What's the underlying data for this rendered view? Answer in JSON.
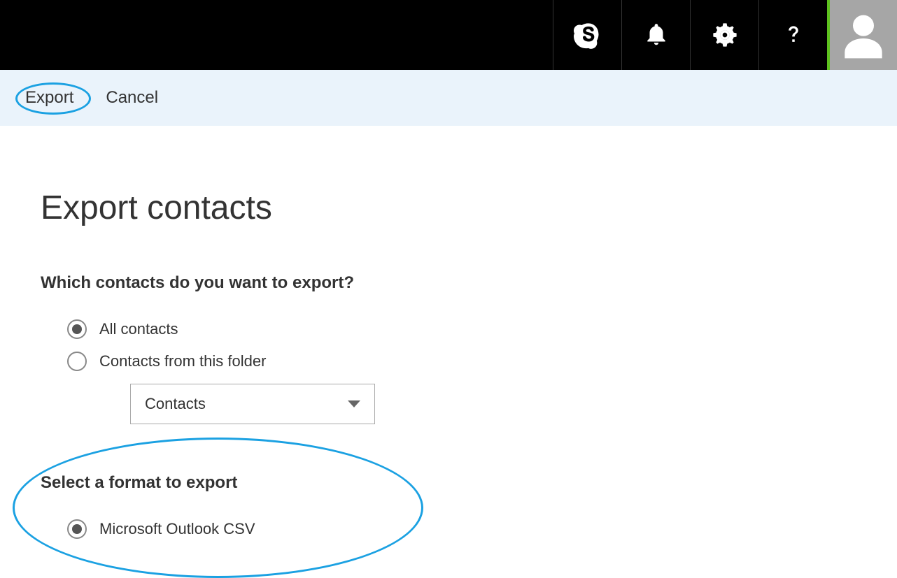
{
  "commandBar": {
    "export_label": "Export",
    "cancel_label": "Cancel"
  },
  "page": {
    "title": "Export contacts",
    "question1": "Which contacts do you want to export?",
    "question2": "Select a format to export"
  },
  "radios_contacts": {
    "all_label": "All contacts",
    "folder_label": "Contacts from this folder",
    "dropdown_selected": "Contacts",
    "all_selected": true,
    "folder_selected": false
  },
  "radios_format": {
    "outlook_label": "Microsoft Outlook CSV",
    "outlook_selected": true
  },
  "icons": {
    "skype": "skype-icon",
    "notifications": "bell-icon",
    "settings": "gear-icon",
    "help": "help-icon",
    "profile": "profile-icon"
  },
  "colors": {
    "highlight": "#1ba1e2",
    "topbar": "#000000",
    "commandbar": "#eaf3fb",
    "accent_green": "#5dc21e"
  }
}
